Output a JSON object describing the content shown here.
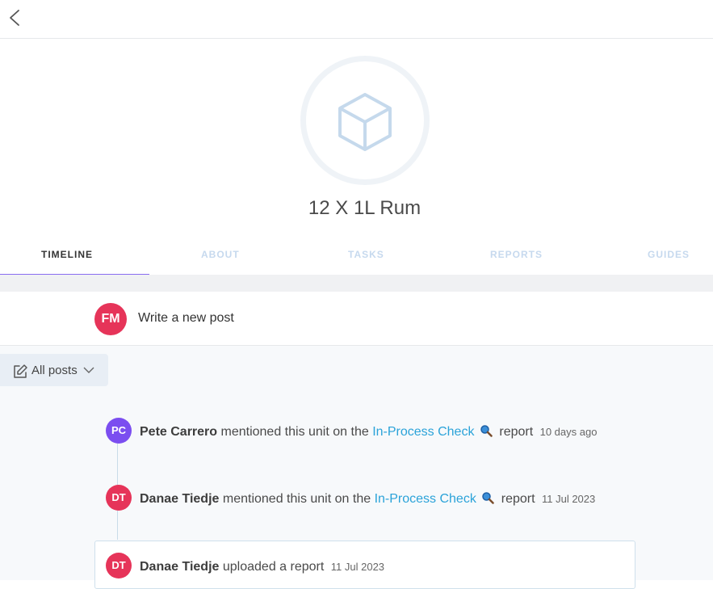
{
  "unit": {
    "title": "12 X 1L Rum"
  },
  "tabs": [
    {
      "label": "TIMELINE"
    },
    {
      "label": "ABOUT"
    },
    {
      "label": "TASKS"
    },
    {
      "label": "REPORTS"
    },
    {
      "label": "GUIDES"
    }
  ],
  "composer": {
    "initials": "FM",
    "placeholder": "Write a new post"
  },
  "filter": {
    "label": "All posts"
  },
  "entries": [
    {
      "initials": "PC",
      "name": "Pete Carrero",
      "action": "mentioned this unit on the",
      "link": "In-Process Check",
      "suffix": "report",
      "time": "10 days ago",
      "color": "#7b4ef0"
    },
    {
      "initials": "DT",
      "name": "Danae Tiedje",
      "action": "mentioned this unit on the",
      "link": "In-Process Check",
      "suffix": "report",
      "time": "11 Jul 2023",
      "color": "#e63459"
    },
    {
      "initials": "DT",
      "name": "Danae Tiedje",
      "action": "uploaded a report",
      "time": "11 Jul 2023",
      "color": "#e63459"
    }
  ],
  "colors": {
    "accent": "#8a6cf0",
    "link": "#2ba3d9",
    "avatar_red": "#e63459",
    "avatar_purple": "#7b4ef0"
  }
}
